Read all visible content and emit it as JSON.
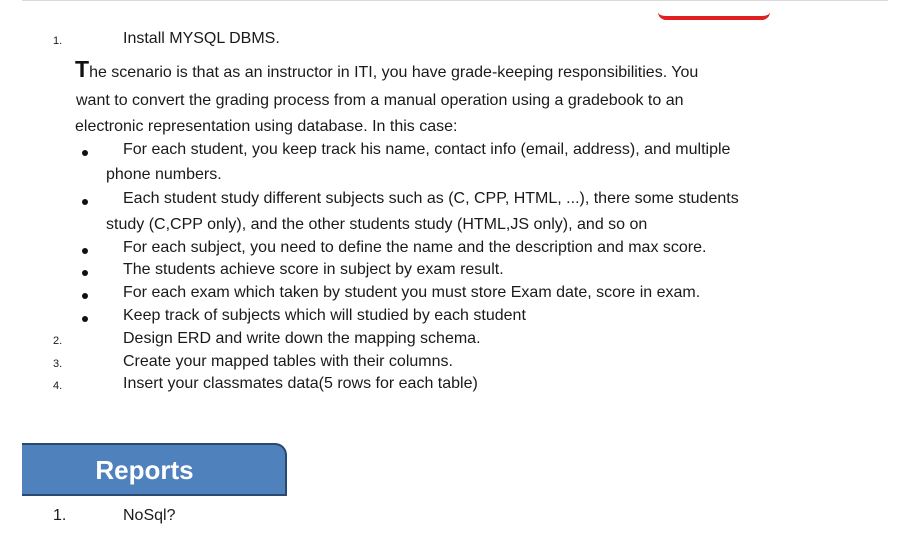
{
  "steps": {
    "s1": {
      "num": "1.",
      "text": "Install MYSQL DBMS."
    },
    "s2": {
      "num": "2.",
      "text": "Design ERD and write down the mapping schema."
    },
    "s3": {
      "num": "3.",
      "text": "Create your mapped tables with their columns."
    },
    "s4": {
      "num": "4.",
      "text": "Insert your classmates data(5 rows for each table)"
    }
  },
  "scenario": {
    "dropcap": "T",
    "line1": "he scenario is that as an instructor in ITI, you have grade-keeping responsibilities. You",
    "line2": "want to convert the grading process from a manual operation using a gradebook to an",
    "line3": "electronic representation using database. In this case:"
  },
  "bullets": {
    "b1": {
      "line1": "For each student, you keep track his name, contact info (email, address), and multiple",
      "line2": "phone numbers."
    },
    "b2": {
      "line1": "Each student study different subjects such as (C, CPP, HTML, ...), there some students",
      "line2": "study (C,CPP only), and the other students study (HTML,JS only), and so on"
    },
    "b3": {
      "line1": "For each subject, you need to define the name and the description and max score."
    },
    "b4": {
      "line1": "The students achieve score in subject by exam result."
    },
    "b5": {
      "line1": "For each exam which taken by student you must store Exam date, score in exam."
    },
    "b6": {
      "line1": "Keep track of subjects which will studied by each student"
    }
  },
  "reports": {
    "title": "Reports",
    "item1": {
      "num": "1.",
      "text": "NoSql?"
    }
  },
  "colors": {
    "reports_fill": "#4f81bd",
    "reports_border": "#2a4970",
    "accent_red": "#e02020"
  }
}
